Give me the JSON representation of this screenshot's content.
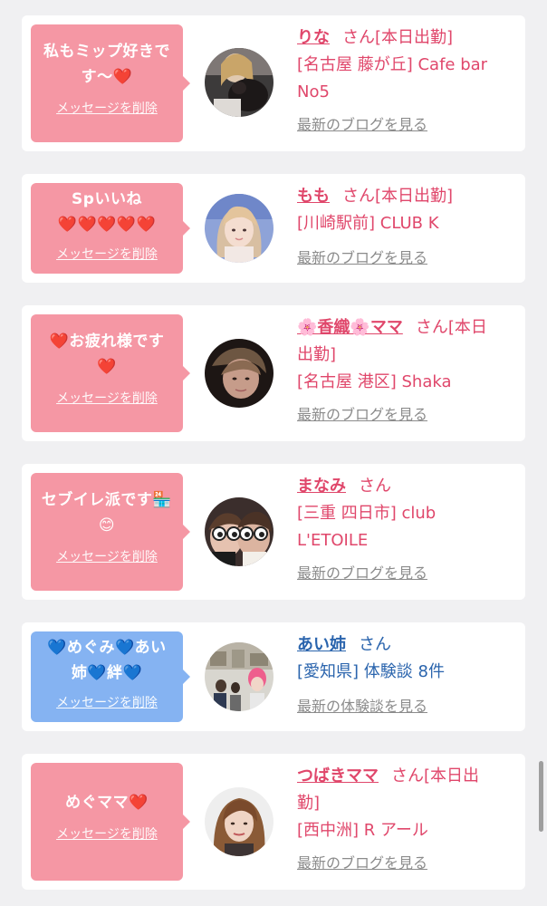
{
  "colors": {
    "page_bg": "#f0f0f2",
    "bubble_pink": "#f597a4",
    "bubble_blue": "#85b3f2",
    "text_pink": "#e0476b",
    "text_blue": "#2a64ad",
    "link_gray": "#8b8b8b"
  },
  "delete_label": "メッセージを削除",
  "entries": [
    {
      "message": [
        "私もミップ好きで",
        "す〜❤️"
      ],
      "bubble_color": "pink",
      "name": "りな",
      "suffix": "さん[本日出勤]",
      "info": [
        "[名古屋 藤が丘] Cafe bar",
        "No5"
      ],
      "link": "最新のブログを見る",
      "avatar": "photo-woman-with-dog"
    },
    {
      "message": [
        "Spいいね",
        "❤️❤️❤️❤️❤️"
      ],
      "bubble_color": "pink",
      "name": "もも",
      "suffix": "さん[本日出勤]",
      "info": [
        "[川崎駅前] CLUB K"
      ],
      "link": "最新のブログを見る",
      "avatar": "photo-woman-blonde"
    },
    {
      "message": [
        "❤️お疲れ様です",
        "❤️"
      ],
      "bubble_color": "pink",
      "name": "🌸香織🌸ママ",
      "suffix": "さん[本日",
      "suffix2": "出勤]",
      "info": [
        "[名古屋 港区] Shaka"
      ],
      "link": "最新のブログを見る",
      "avatar": "photo-woman-dark"
    },
    {
      "message": [
        "セブイレ派です🏪",
        "😊"
      ],
      "bubble_color": "pink",
      "name": "まなみ",
      "suffix": "さん",
      "info": [
        "[三重 四日市] club",
        "L'ETOILE"
      ],
      "link": "最新のブログを見る",
      "avatar": "photo-two-women-filter"
    },
    {
      "message": [
        "💙めぐみ💙あい",
        "姉💙絆💙"
      ],
      "bubble_color": "blue",
      "name": "あい姉",
      "suffix": "さん",
      "info": [
        "[愛知県] 体験談 8件"
      ],
      "link": "最新の体験談を見る",
      "avatar": "photo-event-crowd"
    },
    {
      "message": [
        "めぐママ❤️"
      ],
      "bubble_color": "pink",
      "name": "つばきママ",
      "suffix": "さん[本日出",
      "suffix2": "勤]",
      "info": [
        "[西中洲] R アール"
      ],
      "link": "最新のブログを見る",
      "avatar": "photo-woman-portrait"
    }
  ]
}
